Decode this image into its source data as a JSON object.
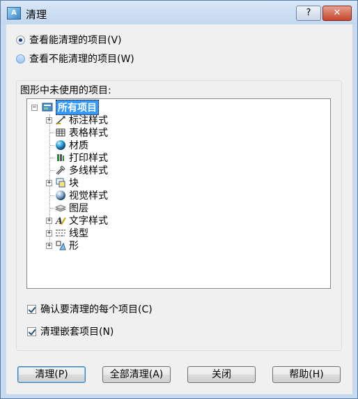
{
  "window": {
    "title": "清理",
    "icon": "cad-app-icon",
    "help_label": "?",
    "close_label": "✕"
  },
  "view_options": [
    {
      "label": "查看能清理的项目(V)",
      "checked": true
    },
    {
      "label": "查看不能清理的项目(W)",
      "checked": false
    }
  ],
  "tree": {
    "group_label": "图形中未使用的项目:",
    "root": "所有项目",
    "items": [
      {
        "label": "标注样式",
        "icon": "dimension-style-icon",
        "expandable": true
      },
      {
        "label": "表格样式",
        "icon": "table-style-icon",
        "expandable": false
      },
      {
        "label": "材质",
        "icon": "material-sphere-icon",
        "expandable": false
      },
      {
        "label": "打印样式",
        "icon": "plot-style-icon",
        "expandable": false
      },
      {
        "label": "多线样式",
        "icon": "multiline-style-icon",
        "expandable": false
      },
      {
        "label": "块",
        "icon": "block-icon",
        "expandable": true
      },
      {
        "label": "视觉样式",
        "icon": "visual-style-icon",
        "expandable": false
      },
      {
        "label": "图层",
        "icon": "layer-icon",
        "expandable": false
      },
      {
        "label": "文字样式",
        "icon": "text-style-icon",
        "expandable": true
      },
      {
        "label": "线型",
        "icon": "linetype-icon",
        "expandable": true
      },
      {
        "label": "形",
        "icon": "shape-icon",
        "expandable": true
      }
    ]
  },
  "options": [
    {
      "label": "确认要清理的每个项目(C)",
      "checked": true
    },
    {
      "label": "清理嵌套项目(N)",
      "checked": true
    }
  ],
  "buttons": {
    "purge": "清理(P)",
    "purge_all": "全部清理(A)",
    "close": "关闭",
    "help": "帮助(H)"
  }
}
